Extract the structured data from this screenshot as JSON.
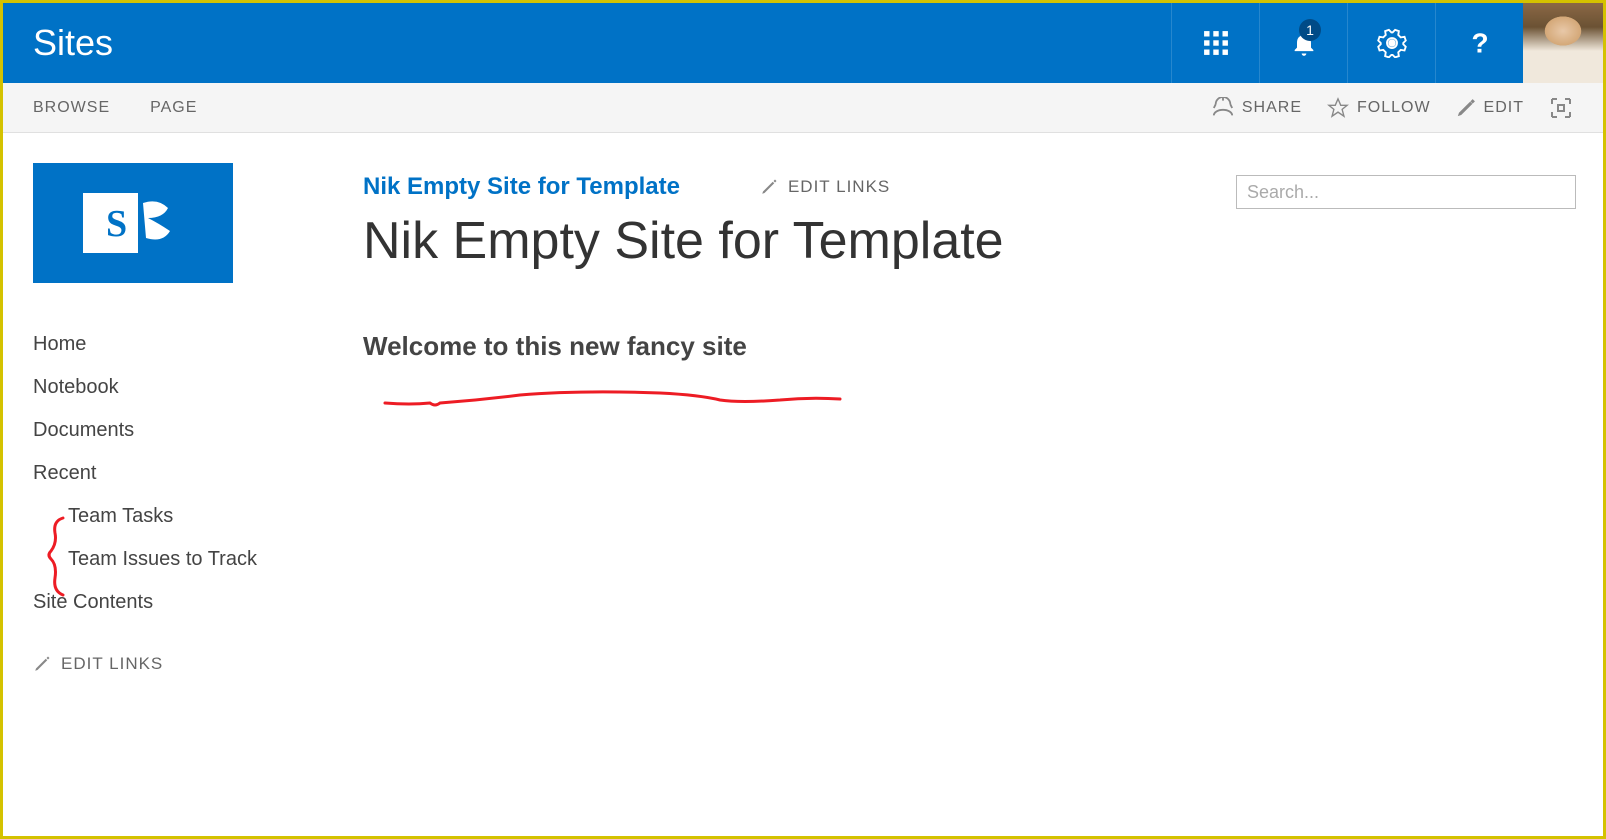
{
  "suite": {
    "brand": "Sites",
    "notification_count": "1"
  },
  "ribbon": {
    "tabs": [
      "BROWSE",
      "PAGE"
    ],
    "actions": {
      "share": "SHARE",
      "follow": "FOLLOW",
      "edit": "EDIT"
    }
  },
  "search": {
    "placeholder": "Search..."
  },
  "siteNav": {
    "title": "Nik Empty Site for Template",
    "editLinks": "EDIT LINKS"
  },
  "pageTitle": "Nik Empty Site for Template",
  "welcome": "Welcome to this new fancy site",
  "quicklaunch": {
    "home": "Home",
    "notebook": "Notebook",
    "documents": "Documents",
    "recent": "Recent",
    "teamTasks": "Team Tasks",
    "teamIssues": "Team Issues to Track",
    "siteContents": "Site Contents",
    "editLinks": "EDIT LINKS"
  }
}
